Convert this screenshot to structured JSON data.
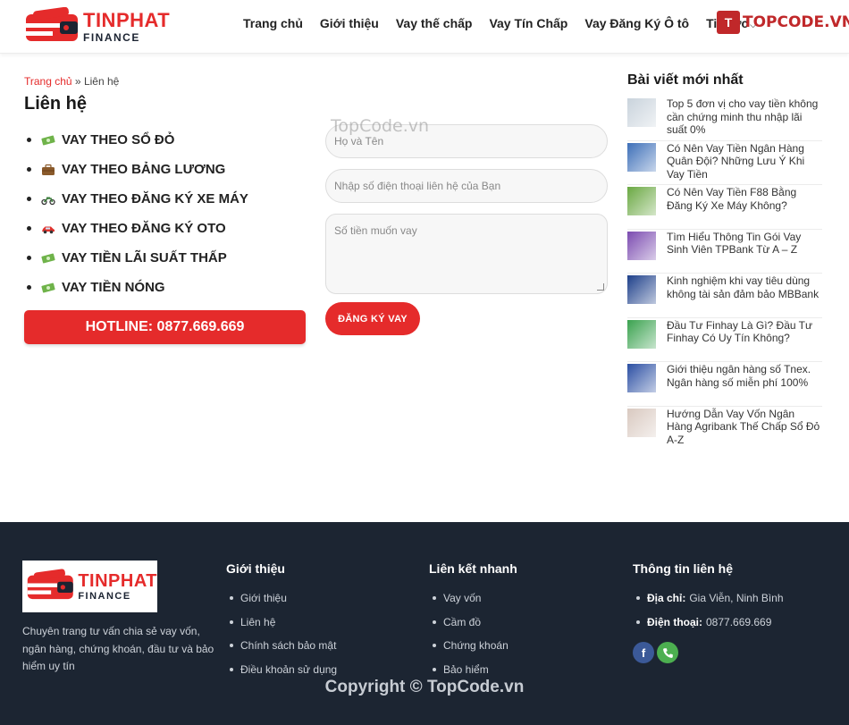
{
  "header": {
    "logo_title": "TINPHAT",
    "logo_sub": "FINANCE",
    "nav": [
      "Trang chủ",
      "Giới thiệu",
      "Vay thế chấp",
      "Vay Tín Chấp",
      "Vay Đăng Ký Ô tô",
      "Tin tức"
    ],
    "brand": "TOPCODE.VN"
  },
  "breadcrumb": {
    "home": "Trang chủ",
    "separator": " » ",
    "current": "Liên hệ"
  },
  "page_title": "Liên hệ",
  "loan_items": [
    {
      "emoji": "money-icon",
      "label": "VAY THEO SỔ ĐỎ"
    },
    {
      "emoji": "briefcase-icon",
      "label": "VAY THEO BẢNG LƯƠNG"
    },
    {
      "emoji": "motorbike-icon",
      "label": "VAY THEO ĐĂNG KÝ XE MÁY"
    },
    {
      "emoji": "car-icon",
      "label": "VAY THEO ĐĂNG KÝ OTO"
    },
    {
      "emoji": "money-icon",
      "label": "VAY TIỀN LÃI SUẤT THẤP"
    },
    {
      "emoji": "money-icon",
      "label": "VAY TIỀN NÓNG"
    }
  ],
  "hotline": "HOTLINE: 0877.669.669",
  "form": {
    "name_placeholder": "Họ và Tên",
    "phone_placeholder": "Nhập số điện thoại liên hệ của Bạn",
    "amount_placeholder": "Số tiền muốn vay",
    "submit_label": "ĐĂNG KÝ VAY"
  },
  "watermark": "TopCode.vn",
  "sidebar": {
    "title": "Bài viết mới nhất",
    "posts": [
      "Top 5 đơn vị cho vay tiền không cần chứng minh thu nhập lãi suất 0%",
      "Có Nên Vay Tiền Ngân Hàng Quân Đội? Những Lưu Ý Khi Vay Tiền",
      "Có Nên Vay Tiền F88 Bằng Đăng Ký Xe Máy Không?",
      "Tìm Hiểu Thông Tin Gói Vay Sinh Viên TPBank Từ A – Z",
      "Kinh nghiệm khi vay tiêu dùng không tài sản đảm bảo MBBank",
      "Đầu Tư Finhay Là Gì? Đầu Tư Finhay Có Uy Tín Không?",
      "Giới thiệu ngân hàng số Tnex. Ngân hàng số miễn phí 100%",
      "Hướng Dẫn Vay Vốn Ngân Hàng Agribank Thế Chấp Sổ Đỏ A-Z"
    ],
    "thumb_colors": [
      "#c9d3dc",
      "#3d6fb8",
      "#6aa842",
      "#7b4bb0",
      "#1d3f8a",
      "#3aa24f",
      "#2b4fa3",
      "#d9c9c0"
    ]
  },
  "footer": {
    "description": "Chuyên trang tư vấn chia sẻ vay vốn, ngân hàng, chứng khoán, đầu tư và bảo hiểm uy tín",
    "about_title": "Giới thiệu",
    "about_links": [
      "Giới thiệu",
      "Liên hệ",
      "Chính sách bảo mật",
      "Điều khoản sử dụng"
    ],
    "quick_title": "Liên kết nhanh",
    "quick_links": [
      "Vay vốn",
      "Cầm đồ",
      "Chứng khoán",
      "Bảo hiểm"
    ],
    "contact_title": "Thông tin liên hệ",
    "address_label": "Địa chỉ:",
    "address_value": "Gia Viễn, Ninh Bình",
    "phone_label": "Điện thoại:",
    "phone_value": "0877.669.669",
    "copyright": "Copyright © TopCode.vn"
  },
  "colors": {
    "accent": "#e52b2b",
    "footer_bg": "#1c2532",
    "facebook": "#3b5998",
    "phone": "#4caf50"
  }
}
